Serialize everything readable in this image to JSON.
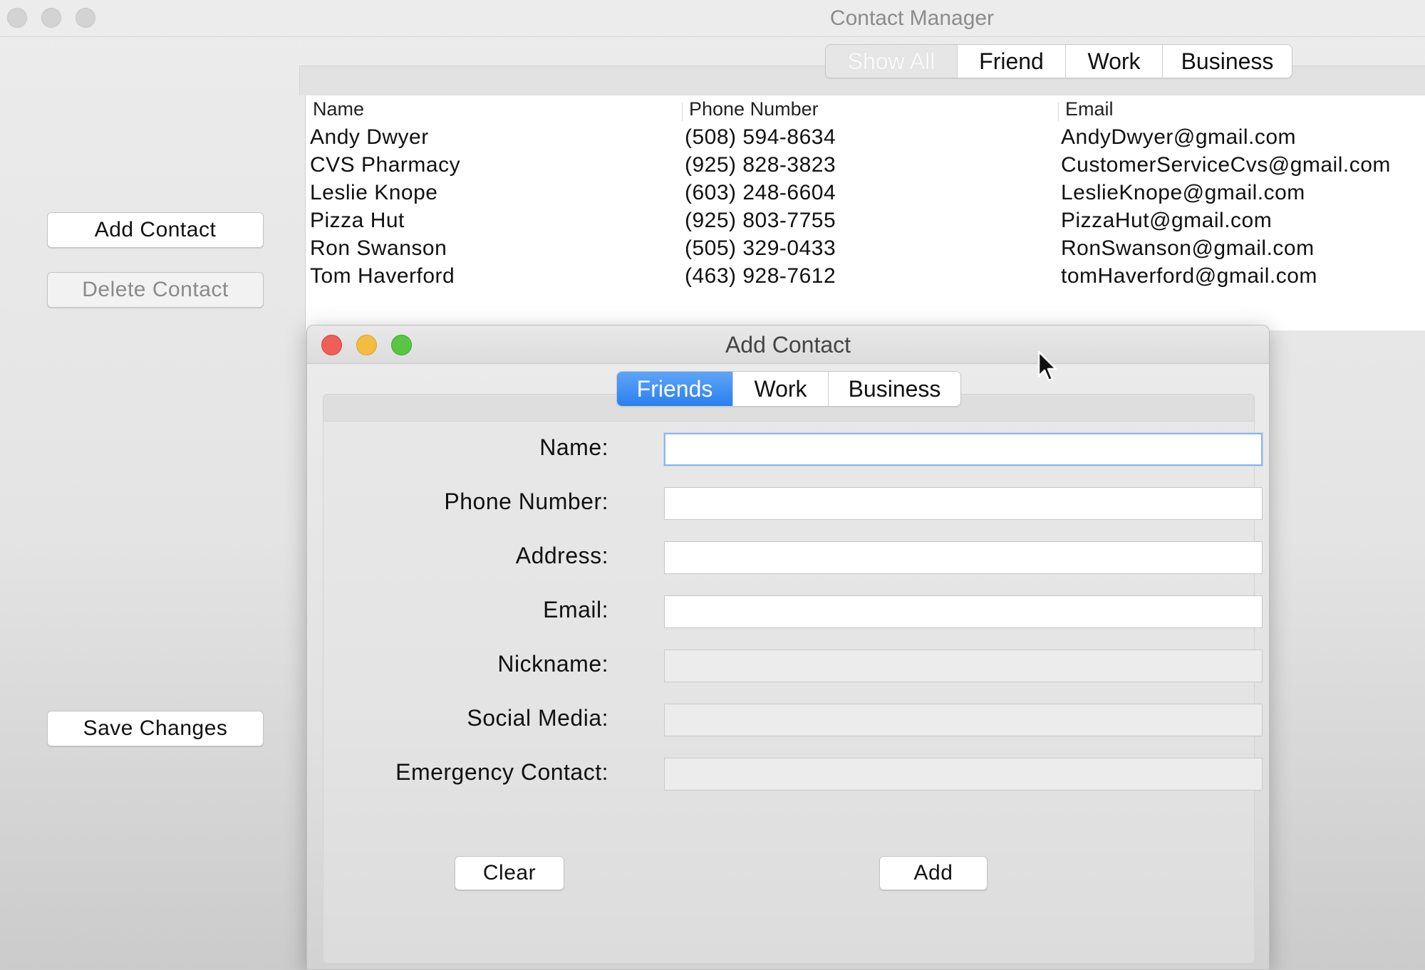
{
  "window": {
    "title": "Contact Manager"
  },
  "filter_tabs": [
    {
      "label": "Show All",
      "state": "disabled"
    },
    {
      "label": "Friend",
      "state": "normal"
    },
    {
      "label": "Work",
      "state": "normal"
    },
    {
      "label": "Business",
      "state": "normal"
    }
  ],
  "table": {
    "columns": [
      "Name",
      "Phone Number",
      "Email"
    ],
    "rows": [
      {
        "name": "Andy Dwyer",
        "phone": "(508) 594-8634",
        "email": "AndyDwyer@gmail.com"
      },
      {
        "name": "CVS Pharmacy",
        "phone": "(925) 828-3823",
        "email": "CustomerServiceCvs@gmail.com"
      },
      {
        "name": "Leslie Knope",
        "phone": "(603) 248-6604",
        "email": "LeslieKnope@gmail.com"
      },
      {
        "name": "Pizza Hut",
        "phone": "(925) 803-7755",
        "email": "PizzaHut@gmail.com"
      },
      {
        "name": "Ron Swanson",
        "phone": "(505) 329-0433",
        "email": "RonSwanson@gmail.com"
      },
      {
        "name": "Tom Haverford",
        "phone": "(463) 928-7612",
        "email": "tomHaverford@gmail.com"
      }
    ]
  },
  "sidebar": {
    "add_contact": "Add Contact",
    "delete_contact": "Delete Contact",
    "save_changes": "Save Changes"
  },
  "dialog": {
    "title": "Add Contact",
    "tabs": [
      {
        "label": "Friends",
        "state": "selected"
      },
      {
        "label": "Work",
        "state": "normal"
      },
      {
        "label": "Business",
        "state": "normal"
      }
    ],
    "fields": [
      {
        "label": "Name:",
        "value": "",
        "state": "focus"
      },
      {
        "label": "Phone Number:",
        "value": "",
        "state": "normal"
      },
      {
        "label": "Address:",
        "value": "",
        "state": "normal"
      },
      {
        "label": "Email:",
        "value": "",
        "state": "normal"
      },
      {
        "label": "Nickname:",
        "value": "",
        "state": "disabled"
      },
      {
        "label": "Social Media:",
        "value": "",
        "state": "disabled"
      },
      {
        "label": "Emergency Contact:",
        "value": "",
        "state": "disabled"
      }
    ],
    "clear_label": "Clear",
    "add_label": "Add"
  },
  "colors": {
    "selected_tab": "#2a7ff0",
    "close_dot": "#ed5f57",
    "minimize_dot": "#f4bd3f",
    "zoom_dot": "#58c543"
  }
}
